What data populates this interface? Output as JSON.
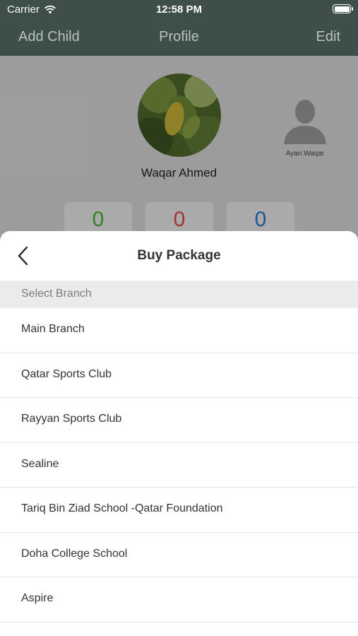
{
  "status_bar": {
    "carrier": "Carrier",
    "time": "12:58 PM"
  },
  "nav": {
    "left_label": "Add Child",
    "title": "Profile",
    "right_label": "Edit"
  },
  "profile": {
    "name": "Waqar Ahmed",
    "child_name": "Ayan Waqar",
    "stats": [
      "0",
      "0",
      "0"
    ],
    "stat_colors": [
      "#49b52f",
      "#e04848",
      "#2f73d6"
    ]
  },
  "sheet": {
    "title": "Buy Package",
    "section_header": "Select Branch",
    "branches": [
      "Main Branch",
      "Qatar Sports Club",
      "Rayyan Sports Club",
      "Sealine",
      "Tariq Bin Ziad School -Qatar Foundation",
      "Doha College School",
      "Aspire"
    ]
  },
  "icons": [
    "wifi-icon",
    "battery-icon",
    "chevron-left-icon",
    "person-placeholder-icon"
  ],
  "colors": {
    "nav_background": "#3e4e48",
    "nav_text": "#b9c3be"
  }
}
